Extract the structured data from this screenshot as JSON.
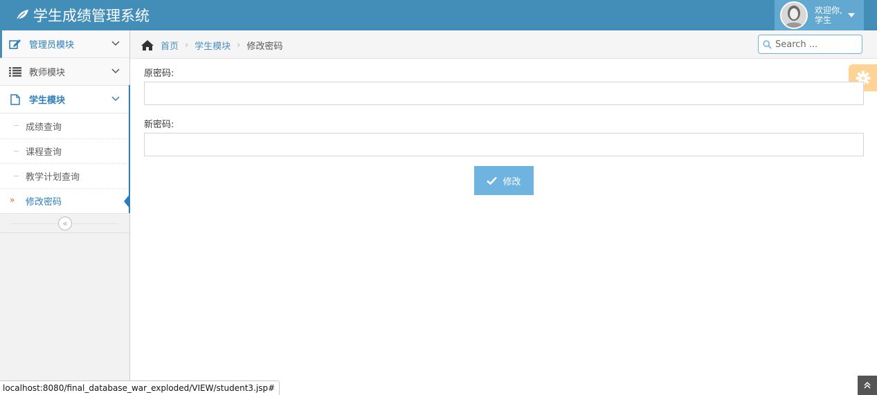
{
  "app": {
    "title": "学生成绩管理系统"
  },
  "user": {
    "welcome": "欢迎你,",
    "name": "学生"
  },
  "sidebar": {
    "items": [
      {
        "label": "管理员模块",
        "icon": "edit-icon"
      },
      {
        "label": "教师模块",
        "icon": "list-icon"
      },
      {
        "label": "学生模块",
        "icon": "file-icon"
      }
    ],
    "submenu": [
      {
        "label": "成绩查询"
      },
      {
        "label": "课程查询"
      },
      {
        "label": "教学计划查询"
      },
      {
        "label": "修改密码"
      }
    ],
    "collapse_symbol": "«"
  },
  "breadcrumb": {
    "home": "首页",
    "module": "学生模块",
    "current": "修改密码"
  },
  "search": {
    "placeholder": "Search ..."
  },
  "form": {
    "old_password_label": "原密码:",
    "new_password_label": "新密码:",
    "old_password_value": "",
    "new_password_value": "",
    "submit_label": "修改"
  },
  "status_bar": {
    "url": "localhost:8080/final_database_war_exploded/VIEW/student3.jsp#"
  },
  "colors": {
    "navbar": "#438eb9",
    "user_box": "#62a8d1",
    "link": "#4c8fbd",
    "active": "#2b7dbc",
    "button": "#6fb3e0",
    "settings": "#ffb752"
  }
}
